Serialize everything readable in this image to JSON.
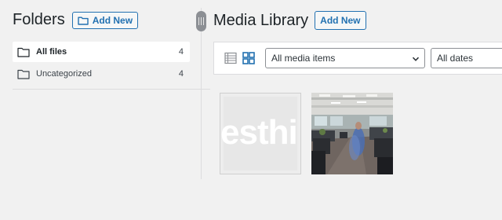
{
  "folders": {
    "title": "Folders",
    "add_new_label": "Add New",
    "items": [
      {
        "label": "All files",
        "count": "4"
      },
      {
        "label": "Uncategorized",
        "count": "4"
      }
    ]
  },
  "media_library": {
    "title": "Media Library",
    "add_new_label": "Add New",
    "filters": {
      "type_selected": "All media items",
      "date_selected": "All dates"
    },
    "thumbnails": [
      {
        "watermark_text": "esthi"
      },
      {
        "kind": "office-photo"
      }
    ]
  },
  "colors": {
    "accent": "#2271b1",
    "background": "#f1f1f1",
    "panel": "#ffffff",
    "border": "#dcdcde"
  },
  "icons": {
    "folder_add": "folder-plus-icon",
    "folder": "folder-icon",
    "list_view": "list-view-icon",
    "grid_view": "grid-view-icon",
    "dropdown": "chevron-down-icon",
    "resize": "resize-handle-icon"
  }
}
